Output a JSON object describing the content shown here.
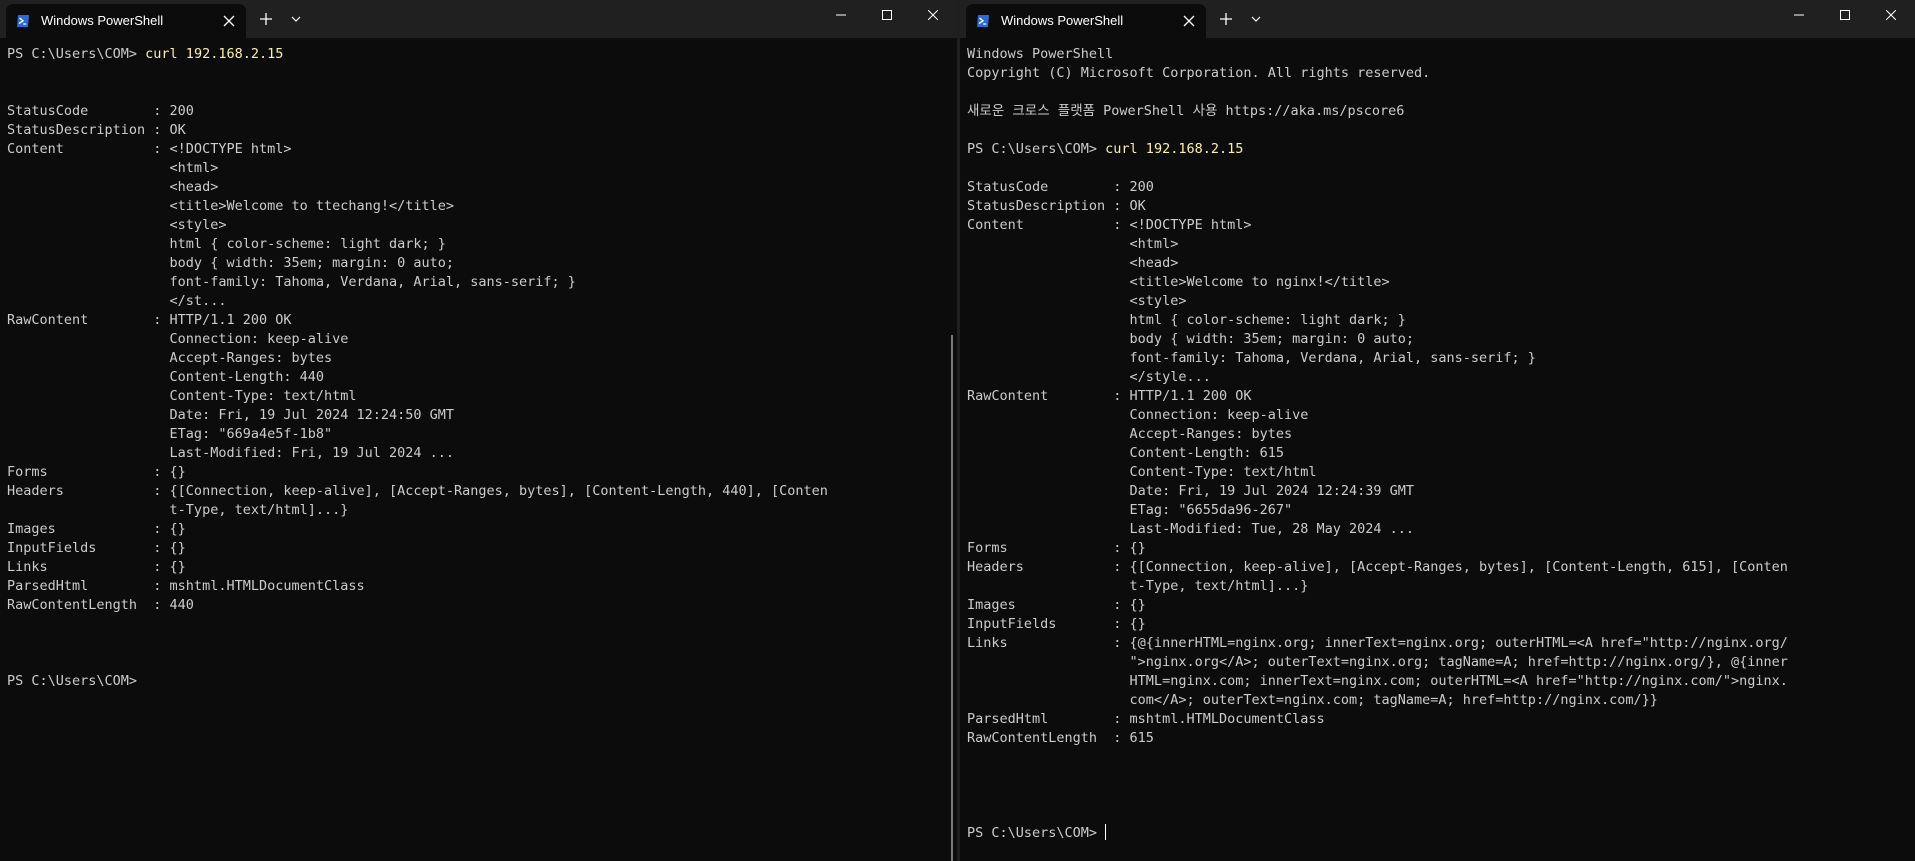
{
  "left": {
    "tab_title": "Windows PowerShell",
    "lines": [
      "PS C:\\Users\\COM> ",
      "",
      "",
      "StatusCode        : 200",
      "StatusDescription : OK",
      "Content           : <!DOCTYPE html>",
      "                    <html>",
      "                    <head>",
      "                    <title>Welcome to ttechang!</title>",
      "                    <style>",
      "                    html { color-scheme: light dark; }",
      "                    body { width: 35em; margin: 0 auto;",
      "                    font-family: Tahoma, Verdana, Arial, sans-serif; }",
      "                    </st...",
      "RawContent        : HTTP/1.1 200 OK",
      "                    Connection: keep-alive",
      "                    Accept-Ranges: bytes",
      "                    Content-Length: 440",
      "                    Content-Type: text/html",
      "                    Date: Fri, 19 Jul 2024 12:24:50 GMT",
      "                    ETag: \"669a4e5f-1b8\"",
      "                    Last-Modified: Fri, 19 Jul 2024 ...",
      "Forms             : {}",
      "Headers           : {[Connection, keep-alive], [Accept-Ranges, bytes], [Content-Length, 440], [Conten",
      "                    t-Type, text/html]...}",
      "Images            : {}",
      "InputFields       : {}",
      "Links             : {}",
      "ParsedHtml        : mshtml.HTMLDocumentClass",
      "RawContentLength  : 440",
      "",
      "",
      "",
      "PS C:\\Users\\COM>"
    ],
    "command": {
      "line_index": 0,
      "text": "curl 192.168.2.15"
    }
  },
  "right": {
    "tab_title": "Windows PowerShell",
    "lines": [
      "Windows PowerShell",
      "Copyright (C) Microsoft Corporation. All rights reserved.",
      "",
      "새로운 크로스 플랫폼 PowerShell 사용 https://aka.ms/pscore6",
      "",
      "PS C:\\Users\\COM> ",
      "",
      "StatusCode        : 200",
      "StatusDescription : OK",
      "Content           : <!DOCTYPE html>",
      "                    <html>",
      "                    <head>",
      "                    <title>Welcome to nginx!</title>",
      "                    <style>",
      "                    html { color-scheme: light dark; }",
      "                    body { width: 35em; margin: 0 auto;",
      "                    font-family: Tahoma, Verdana, Arial, sans-serif; }",
      "                    </style...",
      "RawContent        : HTTP/1.1 200 OK",
      "                    Connection: keep-alive",
      "                    Accept-Ranges: bytes",
      "                    Content-Length: 615",
      "                    Content-Type: text/html",
      "                    Date: Fri, 19 Jul 2024 12:24:39 GMT",
      "                    ETag: \"6655da96-267\"",
      "                    Last-Modified: Tue, 28 May 2024 ...",
      "Forms             : {}",
      "Headers           : {[Connection, keep-alive], [Accept-Ranges, bytes], [Content-Length, 615], [Conten",
      "                    t-Type, text/html]...}",
      "Images            : {}",
      "InputFields       : {}",
      "Links             : {@{innerHTML=nginx.org; innerText=nginx.org; outerHTML=<A href=\"http://nginx.org/",
      "                    \">nginx.org</A>; outerText=nginx.org; tagName=A; href=http://nginx.org/}, @{inner",
      "                    HTML=nginx.com; innerText=nginx.com; outerHTML=<A href=\"http://nginx.com/\">nginx.",
      "                    com</A>; outerText=nginx.com; tagName=A; href=http://nginx.com/}}",
      "ParsedHtml        : mshtml.HTMLDocumentClass",
      "RawContentLength  : 615",
      "",
      "",
      "",
      "",
      "PS C:\\Users\\COM> "
    ],
    "command": {
      "line_index": 5,
      "text": "curl 192.168.2.15"
    },
    "cursor_line_index": 41
  },
  "icons": {
    "tab_icon": "powershell-icon",
    "close": "close-icon",
    "new_tab": "plus-icon",
    "dropdown": "chevron-down-icon",
    "minimize": "minimize-icon",
    "maximize": "maximize-icon"
  },
  "colors": {
    "background": "#0c0c0c",
    "titlebar": "#202020",
    "text": "#cccccc",
    "command": "#f9f1a5",
    "icon_blue": "#2b6bd6"
  }
}
